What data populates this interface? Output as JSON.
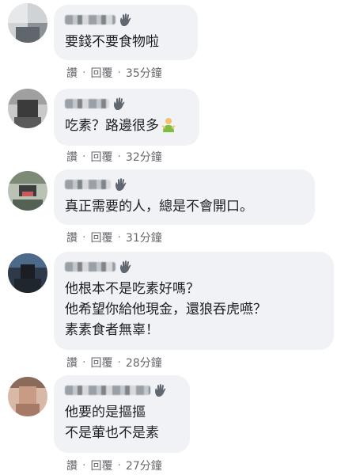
{
  "comments": [
    {
      "text": "要錢不要食物啦",
      "actions": {
        "like": "讚",
        "reply": "回覆",
        "time": "35分鐘"
      }
    },
    {
      "text": "吃素？路邊很多",
      "emoji": "person-gesturing-icon",
      "actions": {
        "like": "讚",
        "reply": "回覆",
        "time": "32分鐘"
      }
    },
    {
      "text": "真正需要的人，總是不會開口。",
      "actions": {
        "like": "讚",
        "reply": "回覆",
        "time": "31分鐘"
      }
    },
    {
      "line1": "他根本不是吃素好嗎？",
      "line2": "他希望你給他現金，還狼吞虎嚥？",
      "line3": "素素食者無辜！",
      "actions": {
        "like": "讚",
        "reply": "回覆",
        "time": "28分鐘"
      }
    },
    {
      "line1": "他要的是摳摳",
      "line2": "不是葷也不是素",
      "actions": {
        "like": "讚",
        "reply": "回覆",
        "time": "27分鐘"
      }
    }
  ],
  "separator": "·",
  "colors": {
    "bubble": "#f0f2f5",
    "meta": "#65676b",
    "text": "#1c1e21"
  }
}
